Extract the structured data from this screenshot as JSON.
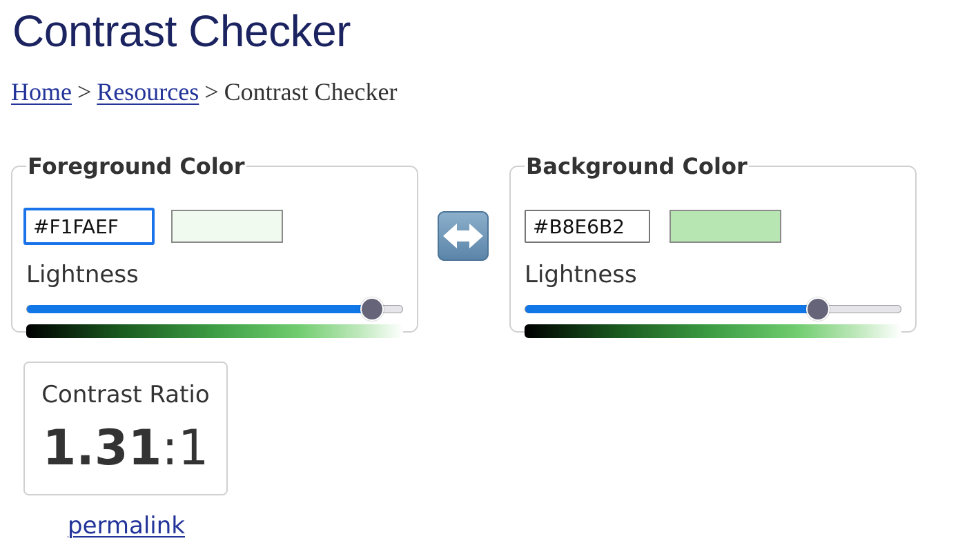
{
  "page": {
    "title": "Contrast Checker"
  },
  "breadcrumb": {
    "home": "Home",
    "resources": "Resources",
    "separator": ">",
    "current": "Contrast Checker"
  },
  "foreground": {
    "legend": "Foreground Color",
    "hex_value": "#F1FAEF",
    "swatch_color": "#F1FAEF",
    "lightness_label": "Lightness",
    "lightness_fraction": 0.92
  },
  "background": {
    "legend": "Background Color",
    "hex_value": "#B8E6B2",
    "swatch_color": "#B8E6B2",
    "lightness_label": "Lightness",
    "lightness_fraction": 0.78
  },
  "swap": {
    "icon": "left-right-arrow-icon",
    "color": "#6b8fb3"
  },
  "result": {
    "label": "Contrast Ratio",
    "ratio_number": "1.31",
    "ratio_suffix": ":1"
  },
  "permalink": {
    "label": "permalink"
  },
  "colors": {
    "title": "#1B2360",
    "link": "#223399",
    "slider_fill": "#1176E6",
    "slider_thumb": "#656479",
    "focus": "#1A73E8"
  }
}
